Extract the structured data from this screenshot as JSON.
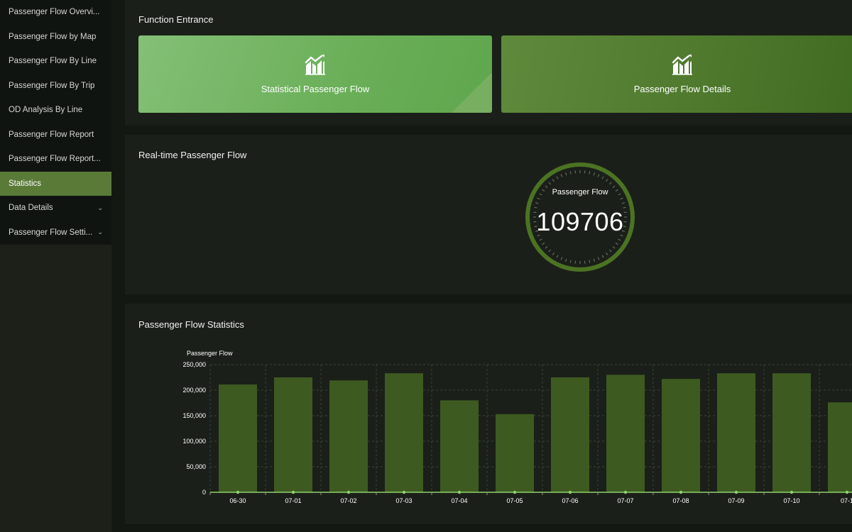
{
  "sidebar": {
    "items": [
      {
        "label": "Passenger Flow Overvi...",
        "active": false,
        "chevron": ""
      },
      {
        "label": "Passenger Flow by Map",
        "active": false,
        "chevron": ""
      },
      {
        "label": "Passenger Flow By Line",
        "active": false,
        "chevron": ""
      },
      {
        "label": "Passenger Flow By Trip",
        "active": false,
        "chevron": ""
      },
      {
        "label": "OD Analysis By Line",
        "active": false,
        "chevron": ""
      },
      {
        "label": "Passenger Flow Report",
        "active": false,
        "chevron": ""
      },
      {
        "label": "Passenger Flow Report...",
        "active": false,
        "chevron": ""
      },
      {
        "label": "Statistics",
        "active": true,
        "chevron": ""
      },
      {
        "label": "Data Details",
        "active": false,
        "chevron": "⌄"
      },
      {
        "label": "Passenger Flow Setti...",
        "active": false,
        "chevron": "⌄"
      }
    ]
  },
  "function_entrance": {
    "title": "Function Entrance",
    "tiles": [
      {
        "label": "Statistical Passenger Flow",
        "icon": "bar-chart-trend-icon"
      },
      {
        "label": "Passenger Flow Details",
        "icon": "bar-chart-trend-icon"
      }
    ]
  },
  "realtime": {
    "title": "Real-time Passenger Flow",
    "gauge_caption": "Passenger Flow",
    "gauge_value": "109706"
  },
  "statistics": {
    "title": "Passenger Flow Statistics"
  },
  "colors": {
    "accent": "#5a7a38",
    "bar": "#3d5a20",
    "line": "#8fd36b",
    "gauge_ring": "#4b7323"
  },
  "chart_data": {
    "type": "bar",
    "ylabel": "Passenger Flow",
    "ylim": [
      0,
      250000
    ],
    "yticks": [
      "0",
      "50,000",
      "100,000",
      "150,000",
      "200,000",
      "250,000"
    ],
    "categories": [
      "06-30",
      "07-01",
      "07-02",
      "07-03",
      "07-04",
      "07-05",
      "07-06",
      "07-07",
      "07-08",
      "07-09",
      "07-10",
      "07-1"
    ],
    "values": [
      211000,
      225000,
      219000,
      233000,
      180000,
      153000,
      225000,
      230000,
      222000,
      233000,
      233000,
      176000
    ],
    "grid": true,
    "legend": "none"
  }
}
